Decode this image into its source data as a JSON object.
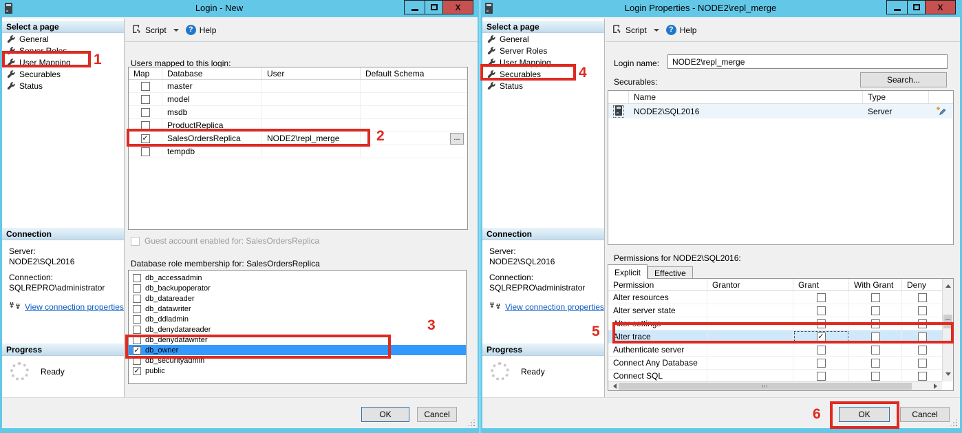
{
  "chrome": {
    "close_glyph": "X"
  },
  "annotations": {
    "steps": [
      "1",
      "2",
      "3",
      "4",
      "5",
      "6"
    ]
  },
  "left": {
    "title": "Login - New",
    "page_list_header": "Select a page",
    "pages": [
      "General",
      "Server Roles",
      "User Mapping",
      "Securables",
      "Status"
    ],
    "toolbar": {
      "script": "Script",
      "help": "Help",
      "help_glyph": "?"
    },
    "users_mapped_label": "Users mapped to this login:",
    "users_table": {
      "h_map": "Map",
      "h_database": "Database",
      "h_user": "User",
      "h_schema": "Default Schema",
      "rows": [
        {
          "c": "",
          "db": "master",
          "user": ""
        },
        {
          "c": "",
          "db": "model",
          "user": ""
        },
        {
          "c": "",
          "db": "msdb",
          "user": ""
        },
        {
          "c": "",
          "db": "ProductReplica",
          "user": ""
        },
        {
          "c": "✓",
          "db": "SalesOrdersReplica",
          "user": "NODE2\\repl_merge"
        },
        {
          "c": "",
          "db": "tempdb",
          "user": ""
        }
      ],
      "browse": "..."
    },
    "guest_label": "Guest account enabled for: SalesOrdersReplica",
    "roles_label": "Database role membership for: SalesOrdersReplica",
    "roles": [
      {
        "c": "",
        "name": "db_accessadmin"
      },
      {
        "c": "",
        "name": "db_backupoperator"
      },
      {
        "c": "",
        "name": "db_datareader"
      },
      {
        "c": "",
        "name": "db_datawriter"
      },
      {
        "c": "",
        "name": "db_ddladmin"
      },
      {
        "c": "",
        "name": "db_denydatareader"
      },
      {
        "c": "",
        "name": "db_denydatawriter"
      },
      {
        "c": "✓",
        "name": "db_owner"
      },
      {
        "c": "",
        "name": "db_securityadmin"
      },
      {
        "c": "✓",
        "name": "public"
      }
    ],
    "connection": {
      "header": "Connection",
      "server_label": "Server:",
      "server": "NODE2\\SQL2016",
      "conn_label": "Connection:",
      "conn": "SQLREPRO\\administrator",
      "link": "View connection properties"
    },
    "progress": {
      "header": "Progress",
      "status": "Ready"
    },
    "ok": "OK",
    "cancel": "Cancel"
  },
  "right": {
    "title": "Login Properties - NODE2\\repl_merge",
    "page_list_header": "Select a page",
    "pages": [
      "General",
      "Server Roles",
      "User Mapping",
      "Securables",
      "Status"
    ],
    "toolbar": {
      "script": "Script",
      "help": "Help",
      "help_glyph": "?"
    },
    "login_name_label": "Login name:",
    "login_name": "NODE2\\repl_merge",
    "securables_label": "Securables:",
    "search": "Search...",
    "securables_table": {
      "h_name": "Name",
      "h_type": "Type",
      "rows": [
        {
          "name": "NODE2\\SQL2016",
          "type": "Server"
        }
      ]
    },
    "permissions_label": "Permissions for NODE2\\SQL2016:",
    "tabs": {
      "explicit": "Explicit",
      "effective": "Effective"
    },
    "perm_table": {
      "h_permission": "Permission",
      "h_grantor": "Grantor",
      "h_grant": "Grant",
      "h_with_grant": "With Grant",
      "h_deny": "Deny",
      "rows": [
        {
          "p": "Alter resources",
          "grant": "",
          "wg": "",
          "deny": ""
        },
        {
          "p": "Alter server state",
          "grant": "",
          "wg": "",
          "deny": ""
        },
        {
          "p": "Alter settings",
          "grant": "",
          "wg": "",
          "deny": ""
        },
        {
          "p": "Alter trace",
          "grant": "✓",
          "wg": "",
          "deny": ""
        },
        {
          "p": "Authenticate server",
          "grant": "",
          "wg": "",
          "deny": ""
        },
        {
          "p": "Connect Any Database",
          "grant": "",
          "wg": "",
          "deny": ""
        },
        {
          "p": "Connect SQL",
          "grant": "",
          "wg": "",
          "deny": ""
        }
      ]
    },
    "connection": {
      "header": "Connection",
      "server_label": "Server:",
      "server": "NODE2\\SQL2016",
      "conn_label": "Connection:",
      "conn": "SQLREPRO\\administrator",
      "link": "View connection properties"
    },
    "progress": {
      "header": "Progress",
      "status": "Ready"
    },
    "ok": "OK",
    "cancel": "Cancel"
  }
}
